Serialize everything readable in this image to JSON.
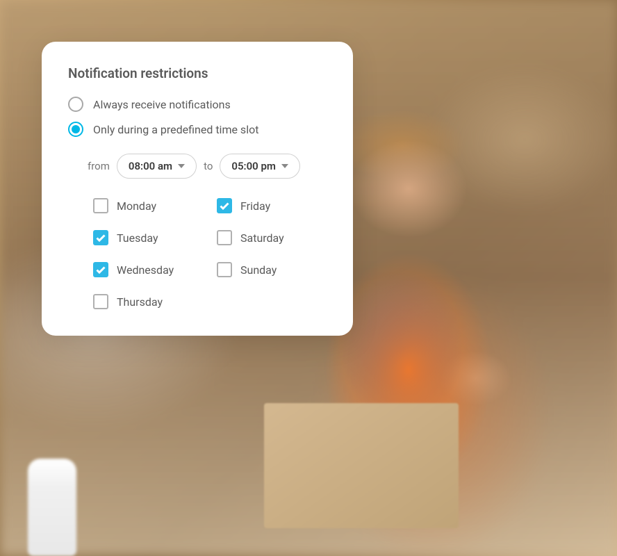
{
  "card": {
    "title": "Notification restrictions",
    "options": {
      "always": {
        "label": "Always receive notifications",
        "selected": false
      },
      "timeslot": {
        "label": "Only during a predefined time slot",
        "selected": true
      }
    },
    "time": {
      "from_label": "from",
      "from_value": "08:00 am",
      "to_label": "to",
      "to_value": "05:00 pm"
    },
    "days": {
      "monday": {
        "label": "Monday",
        "checked": false
      },
      "tuesday": {
        "label": "Tuesday",
        "checked": true
      },
      "wednesday": {
        "label": "Wednesday",
        "checked": true
      },
      "thursday": {
        "label": "Thursday",
        "checked": false
      },
      "friday": {
        "label": "Friday",
        "checked": true
      },
      "saturday": {
        "label": "Saturday",
        "checked": false
      },
      "sunday": {
        "label": "Sunday",
        "checked": false
      }
    }
  },
  "colors": {
    "accent": "#2eb8e6"
  }
}
